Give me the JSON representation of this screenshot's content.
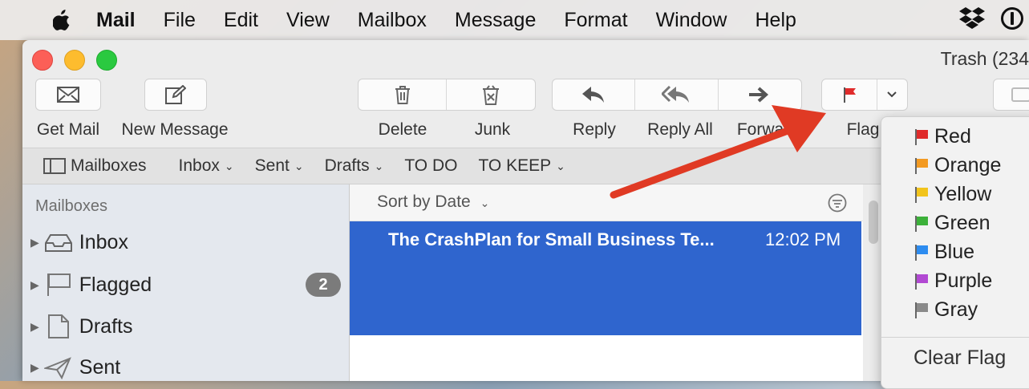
{
  "menubar": {
    "items": [
      "Mail",
      "File",
      "Edit",
      "View",
      "Mailbox",
      "Message",
      "Format",
      "Window",
      "Help"
    ]
  },
  "window": {
    "title": "Trash (234"
  },
  "toolbar": {
    "get_mail": "Get Mail",
    "new_message": "New Message",
    "delete": "Delete",
    "junk": "Junk",
    "reply": "Reply",
    "reply_all": "Reply All",
    "forward": "Forwa",
    "flag": "Flag"
  },
  "favorites": {
    "mailboxes": "Mailboxes",
    "inbox": "Inbox",
    "sent": "Sent",
    "drafts": "Drafts",
    "todo": "TO DO",
    "tokeep": "TO KEEP"
  },
  "sidebar": {
    "header": "Mailboxes",
    "items": [
      {
        "label": "Inbox"
      },
      {
        "label": "Flagged",
        "badge": "2"
      },
      {
        "label": "Drafts"
      },
      {
        "label": "Sent"
      }
    ]
  },
  "message_list": {
    "sort_label": "Sort by Date",
    "messages": [
      {
        "subject": "The CrashPlan for Small Business Te...",
        "time": "12:02 PM",
        "selected": true
      }
    ]
  },
  "flag_menu": {
    "items": [
      {
        "label": "Red",
        "color": "#e02b2b"
      },
      {
        "label": "Orange",
        "color": "#f39a22"
      },
      {
        "label": "Yellow",
        "color": "#f2c41c"
      },
      {
        "label": "Green",
        "color": "#3cb13a"
      },
      {
        "label": "Blue",
        "color": "#2d8cf0"
      },
      {
        "label": "Purple",
        "color": "#b249d3"
      },
      {
        "label": "Gray",
        "color": "#8a8a8a"
      }
    ],
    "clear_label": "Clear Flag"
  },
  "colors": {
    "selection": "#2f65ce",
    "annotation_arrow": "#e03a24"
  }
}
